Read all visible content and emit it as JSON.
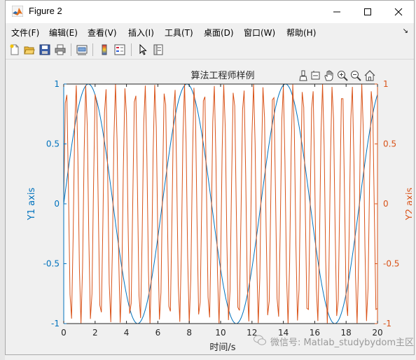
{
  "window": {
    "title": "Figure 2",
    "controls": {
      "minimize": "minimize-icon",
      "maximize": "maximize-icon",
      "close": "close-icon"
    }
  },
  "menu": [
    "文件(F)",
    "编辑(E)",
    "查看(V)",
    "插入(I)",
    "工具(T)",
    "桌面(D)",
    "窗口(W)",
    "帮助(H)"
  ],
  "toolbar": [
    "new-figure-icon",
    "open-file-icon",
    "save-icon",
    "print-icon",
    "link-plot-icon",
    "insert-colorbar-icon",
    "insert-legend-icon",
    "edit-plot-arrow-icon",
    "property-inspector-icon"
  ],
  "axes_toolbar": [
    "brush-icon",
    "data-tips-icon",
    "pan-hand-icon",
    "zoom-in-icon",
    "zoom-out-icon",
    "restore-view-home-icon"
  ],
  "watermark": "微信号: Matlab_studybydom主区",
  "colors": {
    "y1": "#0072BD",
    "y2": "#D95319",
    "text": "#262626"
  },
  "chart_data": {
    "type": "line",
    "title": "算法工程师样例",
    "xlabel": "时间/s",
    "ylabel_left": "Y1 axis",
    "ylabel_right": "Y2 axis",
    "xlim": [
      0,
      20
    ],
    "ylim_left": [
      -1,
      1
    ],
    "ylim_right": [
      -1,
      1
    ],
    "xticks": [
      "0",
      "2",
      "4",
      "6",
      "8",
      "10",
      "12",
      "14",
      "16",
      "18",
      "20"
    ],
    "yticks_left": [
      "-1",
      "-0.5",
      "0",
      "0.5",
      "1"
    ],
    "yticks_right": [
      "-1",
      "-0.5",
      "0",
      "0.5",
      "1"
    ],
    "grid": false,
    "series": [
      {
        "axis": "left",
        "color": "#0072BD",
        "x": [
          0,
          20
        ],
        "function": "y = sin(x)"
      },
      {
        "axis": "right",
        "color": "#D95319",
        "x": [
          0,
          20
        ],
        "function": "y = sin(10x)"
      }
    ]
  }
}
